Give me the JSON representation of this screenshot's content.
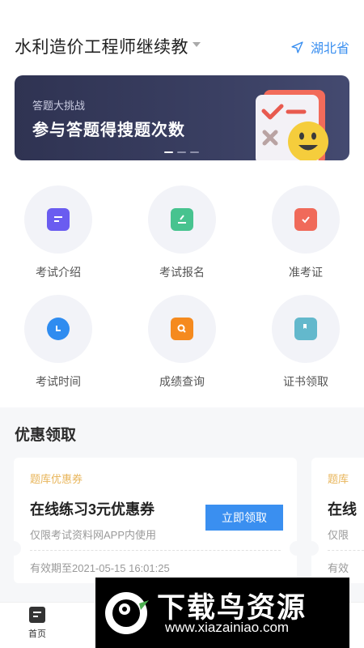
{
  "header": {
    "title": "水利造价工程师继续教",
    "location": "湖北省"
  },
  "banner": {
    "subtitle": "答题大挑战",
    "headline": "参与答题得搜题次数"
  },
  "grid": [
    {
      "label": "考试介绍",
      "icon": "document-icon",
      "color": "#6a5cf0"
    },
    {
      "label": "考试报名",
      "icon": "signup-icon",
      "color": "#47c38f"
    },
    {
      "label": "准考证",
      "icon": "admission-ticket-icon",
      "color": "#f06a5a"
    },
    {
      "label": "考试时间",
      "icon": "clock-icon",
      "color": "#2f8cf0"
    },
    {
      "label": "成绩查询",
      "icon": "search-icon",
      "color": "#f58a1f"
    },
    {
      "label": "证书领取",
      "icon": "certificate-icon",
      "color": "#63b8cc"
    }
  ],
  "coupons_section": {
    "title": "优惠领取",
    "coupons": [
      {
        "tag": "题库优惠券",
        "name": "在线练习3元优惠券",
        "note": "仅限考试资料网APP内使用",
        "button": "立即领取",
        "expire": "有效期至2021-05-15 16:01:25"
      },
      {
        "tag": "题库",
        "name": "在线",
        "note": "仅限",
        "expire": "有效"
      }
    ]
  },
  "bottom_nav": {
    "home_label": "首页"
  },
  "watermark": {
    "title": "下载鸟资源",
    "url": "www.xiazainiao.com"
  },
  "colors": {
    "accent": "#3a8ff0",
    "coupon_tag": "#e8b55a",
    "banner_bg": "#343858"
  }
}
